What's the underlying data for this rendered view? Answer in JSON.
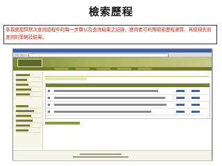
{
  "slide": {
    "title": "檢索歷程",
    "description": "本系統提供默次查詢過程中的每一步驟以及查詢結果之記錄，使用者可利用檢索歷程瀏覽，再檢視先前查詢的策略及結果。"
  },
  "colors": {
    "description_text": "#c81e0a",
    "site_banner": "#7d8a3a",
    "site_menubar": "#6e7a2e",
    "table_header": "#6f8236",
    "link": "#3a5fb0"
  },
  "screenshot": {
    "history_rows": [
      {
        "row": 1
      },
      {
        "row": 2
      },
      {
        "row": 3
      },
      {
        "row": 4
      }
    ]
  }
}
